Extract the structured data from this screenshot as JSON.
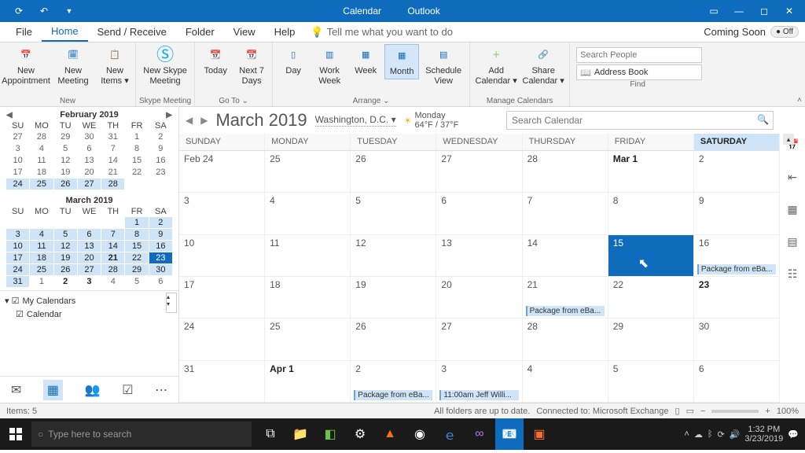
{
  "title": {
    "app": "Calendar",
    "suffix": "Outlook"
  },
  "menubar": [
    "File",
    "Home",
    "Send / Receive",
    "Folder",
    "View",
    "Help"
  ],
  "tellme": "Tell me what you want to do",
  "coming": "Coming Soon",
  "ribbon": {
    "new_group": "New",
    "new_appt": "New Appointment",
    "new_meeting": "New Meeting",
    "new_items": "New Items ▾",
    "skype_group": "Skype Meeting",
    "skype": "New Skype Meeting",
    "goto_group": "Go To",
    "today": "Today",
    "next7": "Next 7 Days",
    "arrange_group": "Arrange",
    "day": "Day",
    "workweek": "Work Week",
    "week": "Week",
    "month": "Month",
    "schedule": "Schedule View",
    "manage_group": "Manage Calendars",
    "addcal": "Add Calendar ▾",
    "sharecal": "Share Calendar ▾",
    "find_group": "Find",
    "search_people_ph": "Search People",
    "address_book": "Address Book"
  },
  "mini": {
    "feb": "February 2019",
    "mar": "March 2019",
    "days": [
      "SU",
      "MO",
      "TU",
      "WE",
      "TH",
      "FR",
      "SA"
    ]
  },
  "mycal": {
    "title": "My Calendars",
    "item": "Calendar"
  },
  "main": {
    "title": "March 2019",
    "location": "Washington,  D.C. ▾",
    "weather_day": "Monday",
    "weather_temp": "64°F / 37°F",
    "search_ph": "Search Calendar",
    "dayheads": [
      "SUNDAY",
      "MONDAY",
      "TUESDAY",
      "WEDNESDAY",
      "THURSDAY",
      "FRIDAY",
      "SATURDAY"
    ]
  },
  "cells": [
    [
      "Feb 24",
      "25",
      "26",
      "27",
      "28",
      "Mar 1",
      "2"
    ],
    [
      "3",
      "4",
      "5",
      "6",
      "7",
      "8",
      "9"
    ],
    [
      "10",
      "11",
      "12",
      "13",
      "14",
      "15",
      "16"
    ],
    [
      "17",
      "18",
      "19",
      "20",
      "21",
      "22",
      "23"
    ],
    [
      "24",
      "25",
      "26",
      "27",
      "28",
      "29",
      "30"
    ],
    [
      "31",
      "Apr 1",
      "2",
      "3",
      "4",
      "5",
      "6"
    ]
  ],
  "events": {
    "pkg": "Package from eBa...",
    "jeff": "11:00am Jeff Willi..."
  },
  "status": {
    "items": "Items: 5",
    "sync": "All folders are up to date.",
    "conn": "Connected to: Microsoft Exchange",
    "zoom": "100%"
  },
  "taskbar": {
    "search_ph": "Type here to search",
    "time": "1:32 PM",
    "date": "3/23/2019"
  }
}
